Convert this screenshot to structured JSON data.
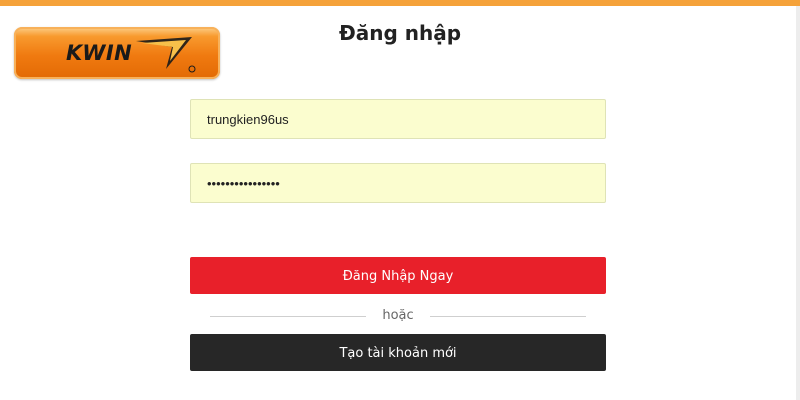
{
  "colors": {
    "accent_top_border": "#f5a23a",
    "login_button": "#e8202a",
    "register_button": "#272727",
    "input_background": "#fbfdcf"
  },
  "logo": {
    "text": "KWIN",
    "mark": "kwin-swoosh-icon"
  },
  "page": {
    "title": "Đăng nhập"
  },
  "form": {
    "username": {
      "value": "trungkien96us"
    },
    "password": {
      "value": "••••••••••••••••"
    },
    "login_button_label": "Đăng Nhập Ngay",
    "divider_text": "hoặc",
    "register_button_label": "Tạo tài khoản mới"
  }
}
